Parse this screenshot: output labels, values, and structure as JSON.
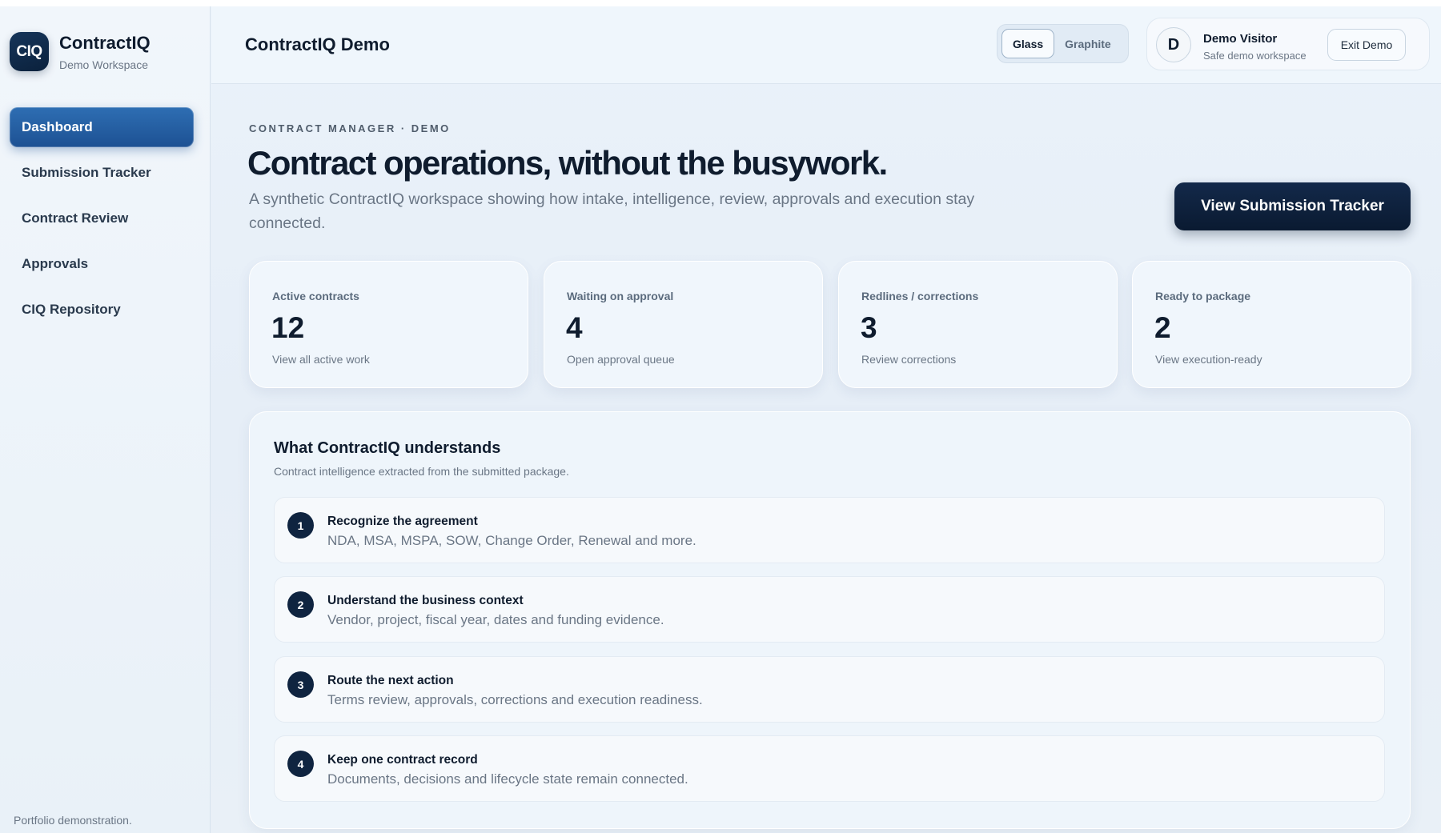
{
  "brand": {
    "logo": "CIQ",
    "name": "ContractIQ",
    "sub": "Demo Workspace"
  },
  "nav": [
    {
      "label": "Dashboard",
      "active": true
    },
    {
      "label": "Submission Tracker",
      "active": false
    },
    {
      "label": "Contract Review",
      "active": false
    },
    {
      "label": "Approvals",
      "active": false
    },
    {
      "label": "CIQ Repository",
      "active": false
    }
  ],
  "sidebar_footer": "Portfolio demonstration.",
  "topbar": {
    "title": "ContractIQ Demo",
    "themes": [
      "Glass",
      "Graphite"
    ],
    "selected_theme": "Glass",
    "user": {
      "initial": "D",
      "name": "Demo Visitor",
      "sub": "Safe demo workspace"
    },
    "exit_label": "Exit Demo"
  },
  "hero": {
    "eyebrow": "CONTRACT MANAGER · DEMO",
    "headline": "Contract operations, without the busywork.",
    "subtitle": "A synthetic ContractIQ workspace showing how intake, intelligence, review, approvals and execution stay connected.",
    "cta_label": "View Submission Tracker"
  },
  "stats": [
    {
      "label": "Active contracts",
      "value": "12",
      "link": "View all active work"
    },
    {
      "label": "Waiting on approval",
      "value": "4",
      "link": "Open approval queue"
    },
    {
      "label": "Redlines / corrections",
      "value": "3",
      "link": "Review corrections"
    },
    {
      "label": "Ready to package",
      "value": "2",
      "link": "View execution-ready"
    }
  ],
  "understands": {
    "title": "What ContractIQ understands",
    "sub": "Contract intelligence extracted from the submitted package.",
    "steps": [
      {
        "num": "1",
        "title": "Recognize the agreement",
        "desc": "NDA, MSA, MSPA, SOW, Change Order, Renewal and more."
      },
      {
        "num": "2",
        "title": "Understand the business context",
        "desc": "Vendor, project, fiscal year, dates and funding evidence."
      },
      {
        "num": "3",
        "title": "Route the next action",
        "desc": "Terms review, approvals, corrections and execution readiness."
      },
      {
        "num": "4",
        "title": "Keep one contract record",
        "desc": "Documents, decisions and lifecycle state remain connected."
      }
    ]
  },
  "colors": {
    "accent": "#1d5193",
    "navy": "#0f2440",
    "text": "#0f1c2e",
    "muted": "#6a7685"
  }
}
